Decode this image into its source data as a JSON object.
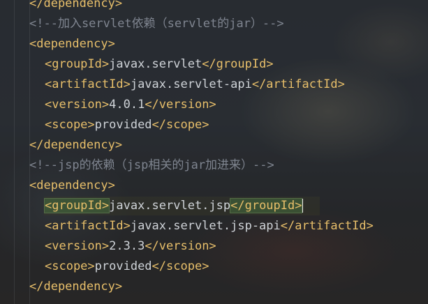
{
  "lines": [
    {
      "indent": 1,
      "parts": [
        [
          "tag",
          "</dependency>"
        ]
      ]
    },
    {
      "indent": 1,
      "parts": [
        [
          "comment",
          "<!--加入servlet依赖（servlet的jar）-->"
        ]
      ]
    },
    {
      "indent": 1,
      "parts": [
        [
          "tag",
          "<dependency>"
        ]
      ]
    },
    {
      "indent": 2,
      "parts": [
        [
          "tag",
          "<groupId>"
        ],
        [
          "text",
          "javax.servlet"
        ],
        [
          "tag",
          "</groupId>"
        ]
      ]
    },
    {
      "indent": 2,
      "parts": [
        [
          "tag",
          "<artifactId>"
        ],
        [
          "text",
          "javax.servlet-api"
        ],
        [
          "tag",
          "</artifactId>"
        ]
      ]
    },
    {
      "indent": 2,
      "parts": [
        [
          "tag",
          "<version>"
        ],
        [
          "text",
          "4.0.1"
        ],
        [
          "tag",
          "</version>"
        ]
      ]
    },
    {
      "indent": 2,
      "parts": [
        [
          "tag",
          "<scope>"
        ],
        [
          "text",
          "provided"
        ],
        [
          "tag",
          "</scope>"
        ]
      ]
    },
    {
      "indent": 1,
      "parts": [
        [
          "tag",
          "</dependency>"
        ]
      ]
    },
    {
      "indent": 1,
      "parts": [
        [
          "comment",
          "<!--jsp的依赖（jsp相关的jar加进来）-->"
        ]
      ]
    },
    {
      "indent": 1,
      "parts": [
        [
          "tag",
          "<dependency>"
        ]
      ]
    },
    {
      "indent": 2,
      "parts": [
        [
          "tag",
          "<groupId>"
        ],
        [
          "text",
          "javax.servlet.jsp"
        ],
        [
          "tag",
          "</groupId>"
        ]
      ],
      "highlighted": true
    },
    {
      "indent": 2,
      "parts": [
        [
          "tag",
          "<artifactId>"
        ],
        [
          "text",
          "javax.servlet.jsp-api"
        ],
        [
          "tag",
          "</artifactId>"
        ]
      ]
    },
    {
      "indent": 2,
      "parts": [
        [
          "tag",
          "<version>"
        ],
        [
          "text",
          "2.3.3"
        ],
        [
          "tag",
          "</version>"
        ]
      ]
    },
    {
      "indent": 2,
      "parts": [
        [
          "tag",
          "<scope>"
        ],
        [
          "text",
          "provided"
        ],
        [
          "tag",
          "</scope>"
        ]
      ]
    },
    {
      "indent": 1,
      "parts": [
        [
          "tag",
          "</dependency>"
        ]
      ]
    }
  ],
  "colors": {
    "tag": "#e8bf6a",
    "text": "#cfd3d8",
    "comment": "#7f8590",
    "match_highlight": "#466e3c"
  }
}
